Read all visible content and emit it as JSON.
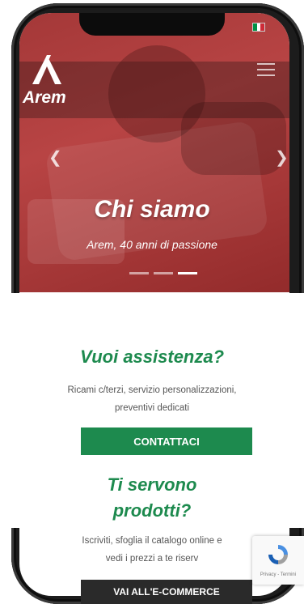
{
  "hero": {
    "logo_text": "Arem",
    "title": "Chi siamo",
    "subtitle": "Arem, 40 anni di passione",
    "slide_count": 3,
    "active_slide": 3
  },
  "assistance": {
    "title": "Vuoi assistenza?",
    "text_line1": "Ricami c/terzi, servizio personalizzazioni,",
    "text_line2": "preventivi dedicati",
    "button_label": "CONTATTACI"
  },
  "products": {
    "title_line1": "Ti servono",
    "title_line2": "prodotti?",
    "text_line1": "Iscriviti, sfoglia il catalogo online e",
    "text_line2": "vedi i prezzi a te riserv",
    "button_label": "VAI ALL'E-COMMERCE"
  },
  "recaptcha": {
    "footer": "Privacy - Termini"
  },
  "colors": {
    "brand_green": "#1d8a4e",
    "hero_red": "#b84444"
  },
  "icons": {
    "menu": "hamburger-icon",
    "prev": "chevron-left-icon",
    "next": "chevron-right-icon",
    "flag": "italy-flag-icon"
  }
}
